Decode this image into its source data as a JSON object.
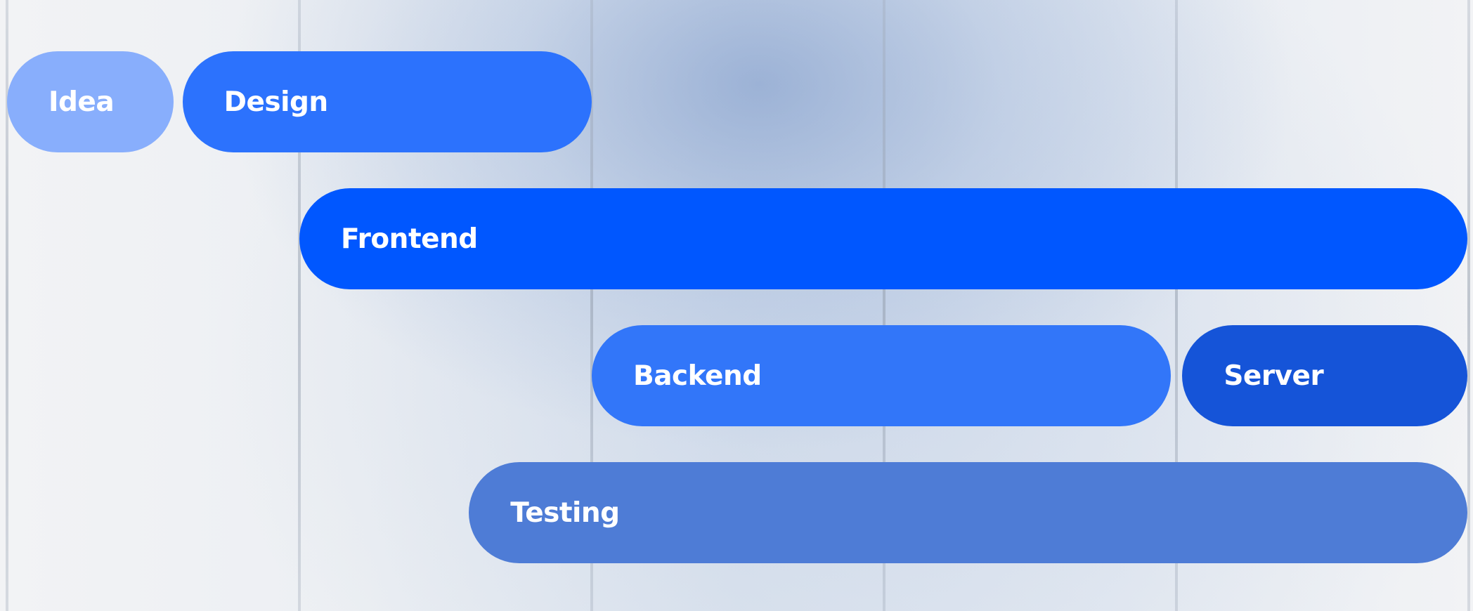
{
  "chart_data": {
    "type": "gantt",
    "gridlines": [
      0,
      1,
      2,
      3,
      4,
      5
    ],
    "rows": 4,
    "tasks": [
      {
        "label": "Idea",
        "row": 0,
        "start": 0.0,
        "end": 0.57,
        "color": "#88aefc"
      },
      {
        "label": "Design",
        "row": 0,
        "start": 0.6,
        "end": 2.0,
        "color": "#2c72fd"
      },
      {
        "label": "Frontend",
        "row": 1,
        "start": 1.0,
        "end": 5.0,
        "color": "#0057ff"
      },
      {
        "label": "Backend",
        "row": 2,
        "start": 2.0,
        "end": 3.98,
        "color": "#3276f9"
      },
      {
        "label": "Server",
        "row": 2,
        "start": 4.02,
        "end": 5.0,
        "color": "#1554d8"
      },
      {
        "label": "Testing",
        "row": 3,
        "start": 1.58,
        "end": 5.0,
        "color": "#4e7cd6"
      }
    ]
  }
}
